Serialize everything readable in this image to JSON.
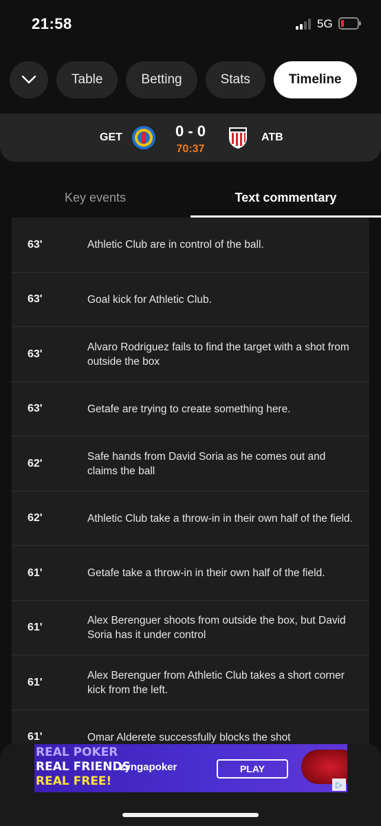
{
  "status": {
    "time": "21:58",
    "network": "5G"
  },
  "tabs": [
    {
      "label": "Table"
    },
    {
      "label": "Betting"
    },
    {
      "label": "Stats"
    },
    {
      "label": "Timeline"
    }
  ],
  "match": {
    "home": "GET",
    "away": "ATB",
    "score": "0 - 0",
    "clock": "70:37",
    "clock_color": "#f07a1e"
  },
  "subtabs": {
    "key_events": "Key events",
    "text_commentary": "Text commentary"
  },
  "commentary": [
    {
      "minute": "63'",
      "text": "Athletic Club are in control of the ball."
    },
    {
      "minute": "63'",
      "text": "Goal kick for Athletic Club."
    },
    {
      "minute": "63'",
      "text": "Alvaro Rodriguez fails to find the target with a shot from outside the box"
    },
    {
      "minute": "63'",
      "text": "Getafe are trying to create something here."
    },
    {
      "minute": "62'",
      "text": "Safe hands from David Soria as he comes out and claims the ball"
    },
    {
      "minute": "62'",
      "text": "Athletic Club take a throw-in in their own half of the field."
    },
    {
      "minute": "61'",
      "text": "Getafe take a throw-in in their own half of the field."
    },
    {
      "minute": "61'",
      "text": "Alex Berenguer shoots from outside the box, but David Soria has it under control"
    },
    {
      "minute": "61'",
      "text": "Alex Berenguer from Athletic Club takes a short corner kick from the left."
    },
    {
      "minute": "61'",
      "text": "Omar Alderete successfully blocks the shot"
    }
  ],
  "ad": {
    "line1": "REAL POKER",
    "line2": "REAL FRIENDS",
    "line3": "REAL FREE!",
    "brand": "zyngapoker",
    "cta": "PLAY"
  }
}
